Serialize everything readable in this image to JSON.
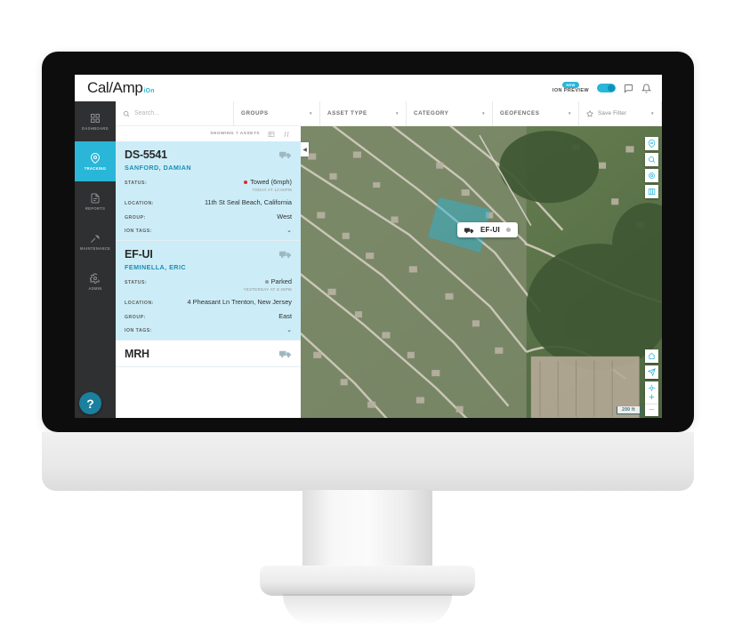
{
  "header": {
    "logo_main": "Cal",
    "logo_slash": "/",
    "logo_second": "Amp",
    "logo_sub": "iOn",
    "new_badge": "NEW",
    "preview_label": "ION PREVIEW",
    "toggle_state": "on",
    "chat_icon": "chat-icon",
    "bell_icon": "bell-icon"
  },
  "sidebar": {
    "items": [
      {
        "label": "DASHBOARD",
        "icon": "dashboard-icon",
        "active": false
      },
      {
        "label": "TRACKING",
        "icon": "location-pin-icon",
        "active": true
      },
      {
        "label": "REPORTS",
        "icon": "reports-icon",
        "active": false
      },
      {
        "label": "MAINTENANCE",
        "icon": "wrench-icon",
        "active": false
      },
      {
        "label": "ADMIN",
        "icon": "gear-icon",
        "active": false
      }
    ],
    "help_label": "?"
  },
  "filters": {
    "search_placeholder": "Search...",
    "groups": "GROUPS",
    "asset_type": "ASSET TYPE",
    "category": "CATEGORY",
    "geofences": "GEOFENCES",
    "save_filter": "Save Filter",
    "caret": "▾"
  },
  "list": {
    "showing": "SHOWING 7 ASSETS",
    "view_icon": "grid-view-icon",
    "sort_icon": "sort-icon",
    "labels": {
      "status": "STATUS:",
      "location": "LOCATION:",
      "group": "GROUP:",
      "ion_tags": "ION TAGS:"
    },
    "assets": [
      {
        "name": "DS-5541",
        "driver": "SANFORD, DAMIAN",
        "status": "Towed (6mph)",
        "status_color": "#e02b2b",
        "timestamp": "TODAY AT 12:00PM",
        "location": "11th St Seal Beach, California",
        "group": "West",
        "selected": true
      },
      {
        "name": "EF-UI",
        "driver": "FEMINELLA, ERIC",
        "status": "Parked",
        "status_color": "#9b9b9b",
        "timestamp": "YESTERDAY AT 8:45PM",
        "location": "4 Pheasant Ln Trenton, New Jersey",
        "group": "East",
        "selected": true
      },
      {
        "name": "MRH",
        "driver": "",
        "status": "",
        "status_color": "#9b9b9b",
        "timestamp": "",
        "location": "",
        "group": "",
        "selected": false
      }
    ]
  },
  "map": {
    "collapse_caret": "◀",
    "marker_label": "EF-UI",
    "marker_icon": "truck-icon",
    "scale": "200 ft",
    "zoom_in": "+",
    "zoom_out": "−",
    "geofence_color": "#29b6d8",
    "tools_top": [
      {
        "icon": "geofence-tool-icon"
      },
      {
        "icon": "search-area-icon"
      },
      {
        "icon": "asset-cluster-icon"
      },
      {
        "icon": "map-layers-icon"
      }
    ],
    "tools_bottom": [
      {
        "icon": "home-icon"
      },
      {
        "icon": "share-location-icon"
      },
      {
        "icon": "recenter-icon"
      }
    ]
  }
}
